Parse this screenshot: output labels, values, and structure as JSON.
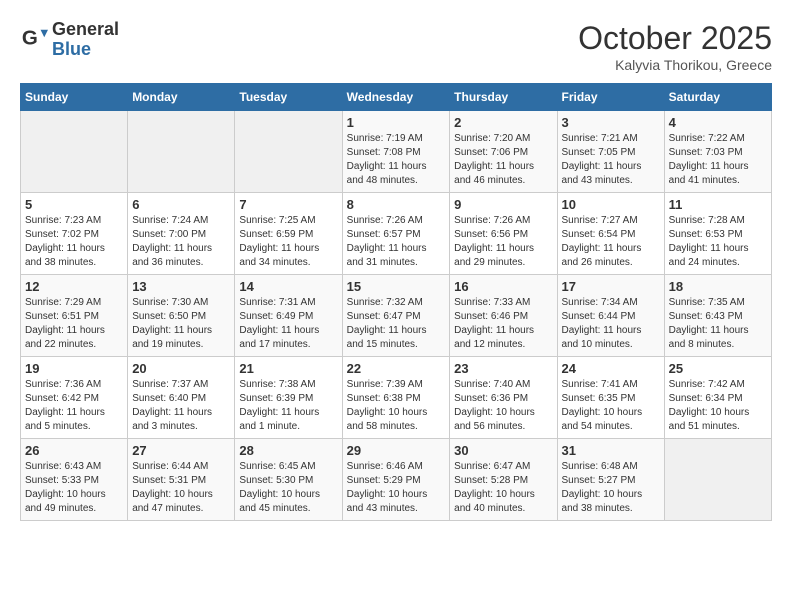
{
  "header": {
    "logo_general": "General",
    "logo_blue": "Blue",
    "month_title": "October 2025",
    "location": "Kalyvia Thorikou, Greece"
  },
  "weekdays": [
    "Sunday",
    "Monday",
    "Tuesday",
    "Wednesday",
    "Thursday",
    "Friday",
    "Saturday"
  ],
  "weeks": [
    [
      {
        "day": "",
        "info": ""
      },
      {
        "day": "",
        "info": ""
      },
      {
        "day": "",
        "info": ""
      },
      {
        "day": "1",
        "info": "Sunrise: 7:19 AM\nSunset: 7:08 PM\nDaylight: 11 hours\nand 48 minutes."
      },
      {
        "day": "2",
        "info": "Sunrise: 7:20 AM\nSunset: 7:06 PM\nDaylight: 11 hours\nand 46 minutes."
      },
      {
        "day": "3",
        "info": "Sunrise: 7:21 AM\nSunset: 7:05 PM\nDaylight: 11 hours\nand 43 minutes."
      },
      {
        "day": "4",
        "info": "Sunrise: 7:22 AM\nSunset: 7:03 PM\nDaylight: 11 hours\nand 41 minutes."
      }
    ],
    [
      {
        "day": "5",
        "info": "Sunrise: 7:23 AM\nSunset: 7:02 PM\nDaylight: 11 hours\nand 38 minutes."
      },
      {
        "day": "6",
        "info": "Sunrise: 7:24 AM\nSunset: 7:00 PM\nDaylight: 11 hours\nand 36 minutes."
      },
      {
        "day": "7",
        "info": "Sunrise: 7:25 AM\nSunset: 6:59 PM\nDaylight: 11 hours\nand 34 minutes."
      },
      {
        "day": "8",
        "info": "Sunrise: 7:26 AM\nSunset: 6:57 PM\nDaylight: 11 hours\nand 31 minutes."
      },
      {
        "day": "9",
        "info": "Sunrise: 7:26 AM\nSunset: 6:56 PM\nDaylight: 11 hours\nand 29 minutes."
      },
      {
        "day": "10",
        "info": "Sunrise: 7:27 AM\nSunset: 6:54 PM\nDaylight: 11 hours\nand 26 minutes."
      },
      {
        "day": "11",
        "info": "Sunrise: 7:28 AM\nSunset: 6:53 PM\nDaylight: 11 hours\nand 24 minutes."
      }
    ],
    [
      {
        "day": "12",
        "info": "Sunrise: 7:29 AM\nSunset: 6:51 PM\nDaylight: 11 hours\nand 22 minutes."
      },
      {
        "day": "13",
        "info": "Sunrise: 7:30 AM\nSunset: 6:50 PM\nDaylight: 11 hours\nand 19 minutes."
      },
      {
        "day": "14",
        "info": "Sunrise: 7:31 AM\nSunset: 6:49 PM\nDaylight: 11 hours\nand 17 minutes."
      },
      {
        "day": "15",
        "info": "Sunrise: 7:32 AM\nSunset: 6:47 PM\nDaylight: 11 hours\nand 15 minutes."
      },
      {
        "day": "16",
        "info": "Sunrise: 7:33 AM\nSunset: 6:46 PM\nDaylight: 11 hours\nand 12 minutes."
      },
      {
        "day": "17",
        "info": "Sunrise: 7:34 AM\nSunset: 6:44 PM\nDaylight: 11 hours\nand 10 minutes."
      },
      {
        "day": "18",
        "info": "Sunrise: 7:35 AM\nSunset: 6:43 PM\nDaylight: 11 hours\nand 8 minutes."
      }
    ],
    [
      {
        "day": "19",
        "info": "Sunrise: 7:36 AM\nSunset: 6:42 PM\nDaylight: 11 hours\nand 5 minutes."
      },
      {
        "day": "20",
        "info": "Sunrise: 7:37 AM\nSunset: 6:40 PM\nDaylight: 11 hours\nand 3 minutes."
      },
      {
        "day": "21",
        "info": "Sunrise: 7:38 AM\nSunset: 6:39 PM\nDaylight: 11 hours\nand 1 minute."
      },
      {
        "day": "22",
        "info": "Sunrise: 7:39 AM\nSunset: 6:38 PM\nDaylight: 10 hours\nand 58 minutes."
      },
      {
        "day": "23",
        "info": "Sunrise: 7:40 AM\nSunset: 6:36 PM\nDaylight: 10 hours\nand 56 minutes."
      },
      {
        "day": "24",
        "info": "Sunrise: 7:41 AM\nSunset: 6:35 PM\nDaylight: 10 hours\nand 54 minutes."
      },
      {
        "day": "25",
        "info": "Sunrise: 7:42 AM\nSunset: 6:34 PM\nDaylight: 10 hours\nand 51 minutes."
      }
    ],
    [
      {
        "day": "26",
        "info": "Sunrise: 6:43 AM\nSunset: 5:33 PM\nDaylight: 10 hours\nand 49 minutes."
      },
      {
        "day": "27",
        "info": "Sunrise: 6:44 AM\nSunset: 5:31 PM\nDaylight: 10 hours\nand 47 minutes."
      },
      {
        "day": "28",
        "info": "Sunrise: 6:45 AM\nSunset: 5:30 PM\nDaylight: 10 hours\nand 45 minutes."
      },
      {
        "day": "29",
        "info": "Sunrise: 6:46 AM\nSunset: 5:29 PM\nDaylight: 10 hours\nand 43 minutes."
      },
      {
        "day": "30",
        "info": "Sunrise: 6:47 AM\nSunset: 5:28 PM\nDaylight: 10 hours\nand 40 minutes."
      },
      {
        "day": "31",
        "info": "Sunrise: 6:48 AM\nSunset: 5:27 PM\nDaylight: 10 hours\nand 38 minutes."
      },
      {
        "day": "",
        "info": ""
      }
    ]
  ]
}
